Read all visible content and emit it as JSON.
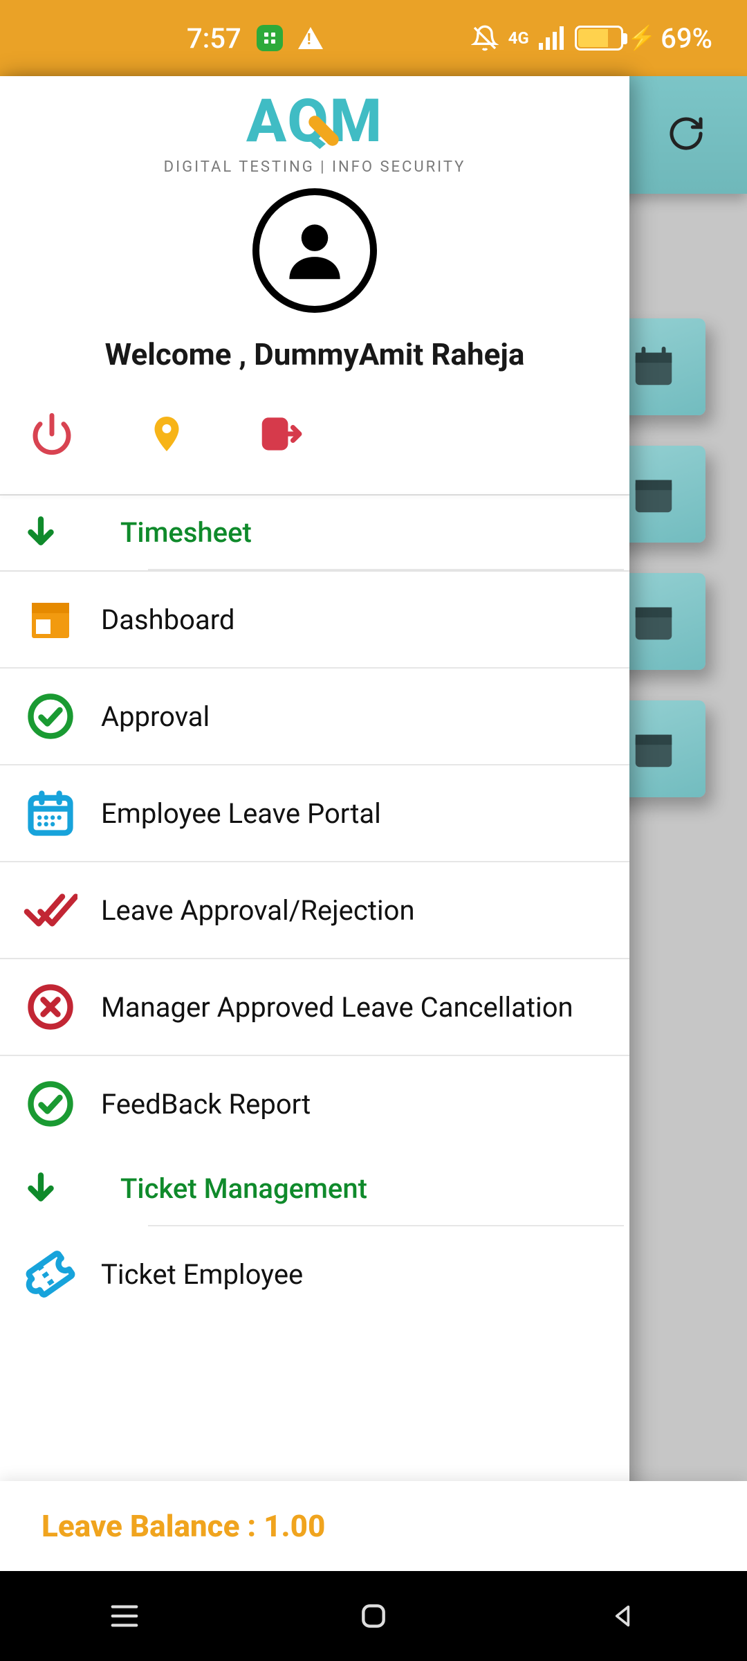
{
  "status": {
    "time": "7:57",
    "battery_pct": "69%",
    "network_label": "4G"
  },
  "header": {
    "sync_icon": "sync"
  },
  "drawer": {
    "logo": {
      "main": "AQM",
      "sub": "DIGITAL TESTING | INFO SECURITY"
    },
    "welcome": "Welcome , DummyAmit Raheja",
    "actions": {
      "power": "power",
      "location": "location",
      "logout": "logout"
    },
    "sections": [
      {
        "title": "Timesheet"
      },
      {
        "title": "Ticket Management"
      }
    ],
    "menu": {
      "dashboard": "Dashboard",
      "approval": "Approval",
      "elp": "Employee Leave Portal",
      "lar": "Leave Approval/Rejection",
      "malc": "Manager Approved Leave Cancellation",
      "feedback": "FeedBack Report",
      "ticket_emp": "Ticket Employee"
    },
    "balance": "Leave Balance : 1.00"
  }
}
